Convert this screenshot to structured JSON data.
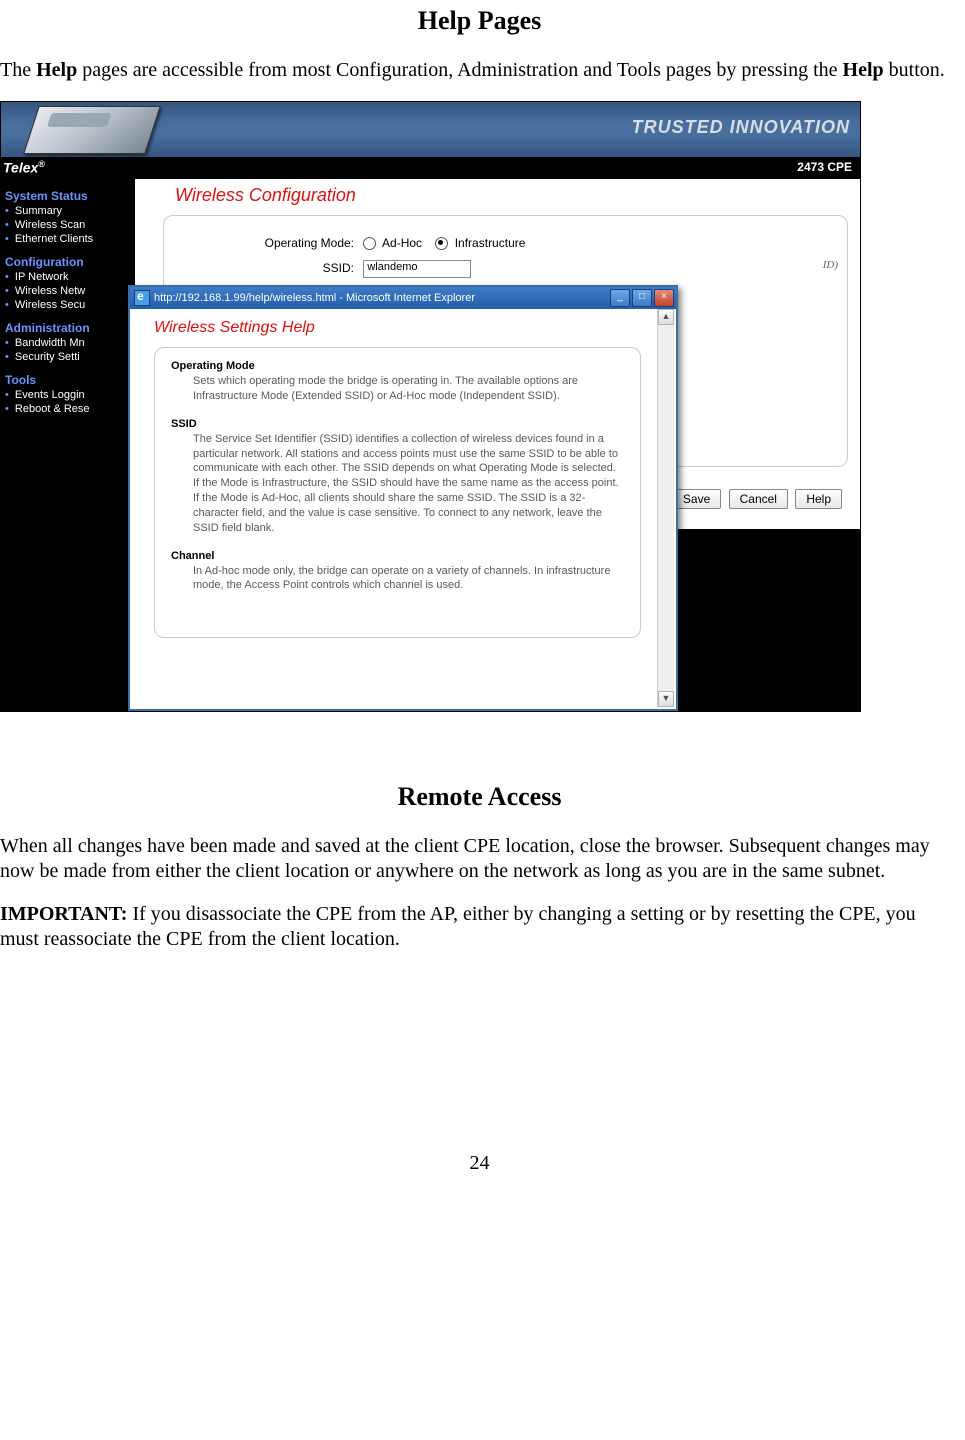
{
  "doc": {
    "heading1": "Help Pages",
    "intro_pre_bold1": "The ",
    "intro_bold1": "Help",
    "intro_mid": " pages are accessible from most Configuration, Administration and Tools pages by pressing the ",
    "intro_bold2": "Help",
    "intro_post": " button.",
    "heading2": "Remote Access",
    "remote_p1": "When all changes have been made and saved at the client CPE location, close the browser. Subsequent changes may now be made from either the client location or anywhere on the network as long as you are in the same subnet.",
    "important_label": "IMPORTANT:",
    "important_text": "  If you disassociate the CPE from the AP, either by changing a setting or by resetting the CPE, you must reassociate the CPE from the client location.",
    "page_number": "24"
  },
  "banner": {
    "tagline": "TRUSTED INNOVATION"
  },
  "brandbar": {
    "brand": "Telex",
    "reg": "®",
    "model": "2473 CPE"
  },
  "sidebar": {
    "groups": [
      {
        "title": "System Status",
        "items": [
          "Summary",
          "Wireless Scan",
          "Ethernet Clients"
        ]
      },
      {
        "title": "Configuration",
        "items": [
          "IP Network",
          "Wireless Netw",
          "Wireless Secu"
        ]
      },
      {
        "title": "Administration",
        "items": [
          "Bandwidth Mn",
          "Security Setti"
        ]
      },
      {
        "title": "Tools",
        "items": [
          "Events Loggin",
          "Reboot & Rese"
        ]
      }
    ]
  },
  "main": {
    "title": "Wireless Configuration",
    "mode_label": "Operating Mode:",
    "mode_opt1": "Ad-Hoc",
    "mode_opt2": "Infrastructure",
    "ssid_label": "SSID:",
    "ssid_value": "wlandemo",
    "ssid_hint_suffix": "ID)",
    "buttons": {
      "save": "Save",
      "cancel": "Cancel",
      "help": "Help"
    }
  },
  "popup": {
    "title": "http://192.168.1.99/help/wireless.html - Microsoft Internet Explorer",
    "page_title": "Wireless Settings Help",
    "topics": [
      {
        "title": "Operating Mode",
        "body": "Sets which operating mode the bridge is operating in. The available options are Infrastructure Mode (Extended SSID) or Ad-Hoc mode (Independent SSID)."
      },
      {
        "title": "SSID",
        "body": "The Service Set Identifier (SSID) identifies a collection of wireless devices found in a particular network. All stations and access points must use the same SSID to be able to communicate with each other.\nThe SSID depends on what Operating Mode is selected. If the Mode is Infrastructure, the SSID should have the same name as the access point. If the Mode is Ad-Hoc, all clients should share the same SSID.\nThe SSID is a 32-character field, and the value is case sensitive. To connect to any network, leave the SSID field blank."
      },
      {
        "title": "Channel",
        "body": "In Ad-hoc mode only, the bridge can operate on a variety of channels. In infrastructure mode, the Access Point controls which channel is used."
      }
    ]
  }
}
